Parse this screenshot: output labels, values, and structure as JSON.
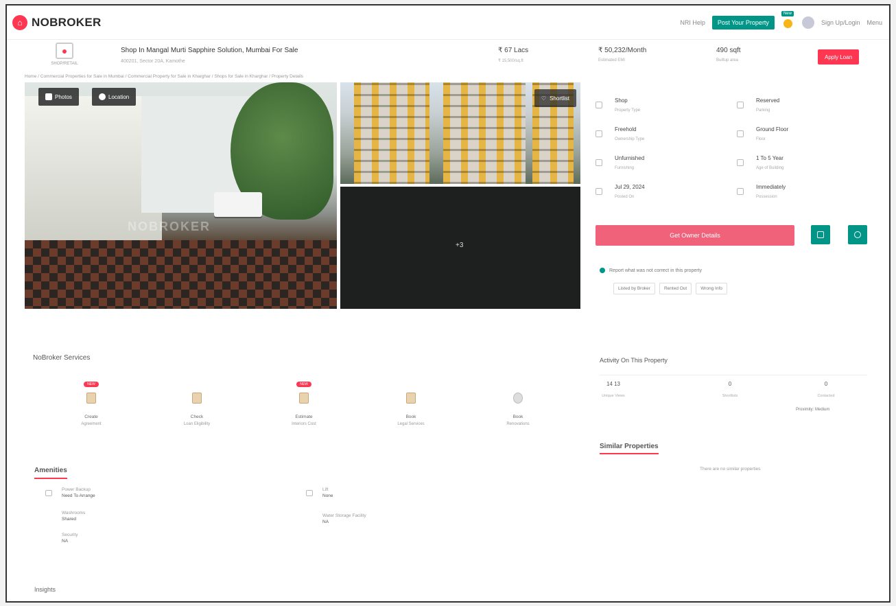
{
  "header": {
    "logo_text": "NOBROKER",
    "link_small": "NRI Help",
    "post_button": "Post Your Property",
    "new_tag": "New",
    "user_label": "Sign Up/Login",
    "menu_label": "Menu"
  },
  "property": {
    "icon_label": "SHOP/RETAIL",
    "title": "Shop In Mangal Murti Sapphire Solution, Mumbai For Sale",
    "subtitle": "400201, Sector 20A, Kamothe",
    "price": "₹ 67 Lacs",
    "price_label": "₹ 15,500/sq.ft",
    "emi": "₹ 50,232/Month",
    "emi_label": "Estimated EMI",
    "area": "490 sqft",
    "area_label": "Builtup area",
    "apply_button": "Apply Loan"
  },
  "breadcrumb": "Home / Commercial Properties for Sale in Mumbai / Commercial Property for Sale in Kharghar / Shops for Sale in Kharghar / Property Details",
  "gallery": {
    "photos_button": "Photos",
    "location_button": "Location",
    "shortlist_button": "Shortlist",
    "watermark": "NOBROKER",
    "more_label": "+3"
  },
  "details": [
    {
      "value": "Shop",
      "label": "Property Type"
    },
    {
      "value": "Reserved",
      "label": "Parking"
    },
    {
      "value": "Freehold",
      "label": "Ownership Type"
    },
    {
      "value": "Ground Floor",
      "label": "Floor"
    },
    {
      "value": "Unfurnished",
      "label": "Furnishing"
    },
    {
      "value": "1 To 5 Year",
      "label": "Age of Building"
    },
    {
      "value": "Jul 29, 2024",
      "label": "Posted On"
    },
    {
      "value": "Immediately",
      "label": "Possession"
    }
  ],
  "owner_button": "Get Owner Details",
  "report_text": "Report what was not correct in this property",
  "report_chips": [
    "Listed by Broker",
    "Rented Out",
    "Wrong Info"
  ],
  "activity": {
    "title": "Activity On This Property",
    "items": [
      {
        "value": "14 13",
        "label": "Unique Views"
      },
      {
        "value": "0",
        "label": "Shortlists"
      },
      {
        "value": "0",
        "label": "Contacted"
      }
    ],
    "footer": "Proximity: Medium"
  },
  "similar": {
    "title": "Similar Properties",
    "empty": "There are no similar properties"
  },
  "services": {
    "title": "NoBroker Services",
    "items": [
      {
        "badge": "NEW",
        "line1": "Create",
        "line2": "Agreement"
      },
      {
        "badge": "",
        "line1": "Check",
        "line2": "Loan Eligibility"
      },
      {
        "badge": "NEW",
        "line1": "Estimate",
        "line2": "Interiors Cost"
      },
      {
        "badge": "",
        "line1": "Book",
        "line2": "Legal Services"
      },
      {
        "badge": "",
        "line1": "Book",
        "line2": "Renovations"
      }
    ]
  },
  "amenities": {
    "title": "Amenities",
    "items": [
      {
        "label": "Power Backup",
        "value": "Need To Arrange"
      },
      {
        "label": "Lift",
        "value": "None"
      },
      {
        "label": "Washrooms",
        "value": "Shared"
      },
      {
        "label": "Water Storage Facility",
        "value": "NA"
      },
      {
        "label": "Security",
        "value": "NA"
      }
    ]
  },
  "insights_title": "Insights",
  "colors": {
    "brand": "#fd3752",
    "accent": "#009587"
  }
}
